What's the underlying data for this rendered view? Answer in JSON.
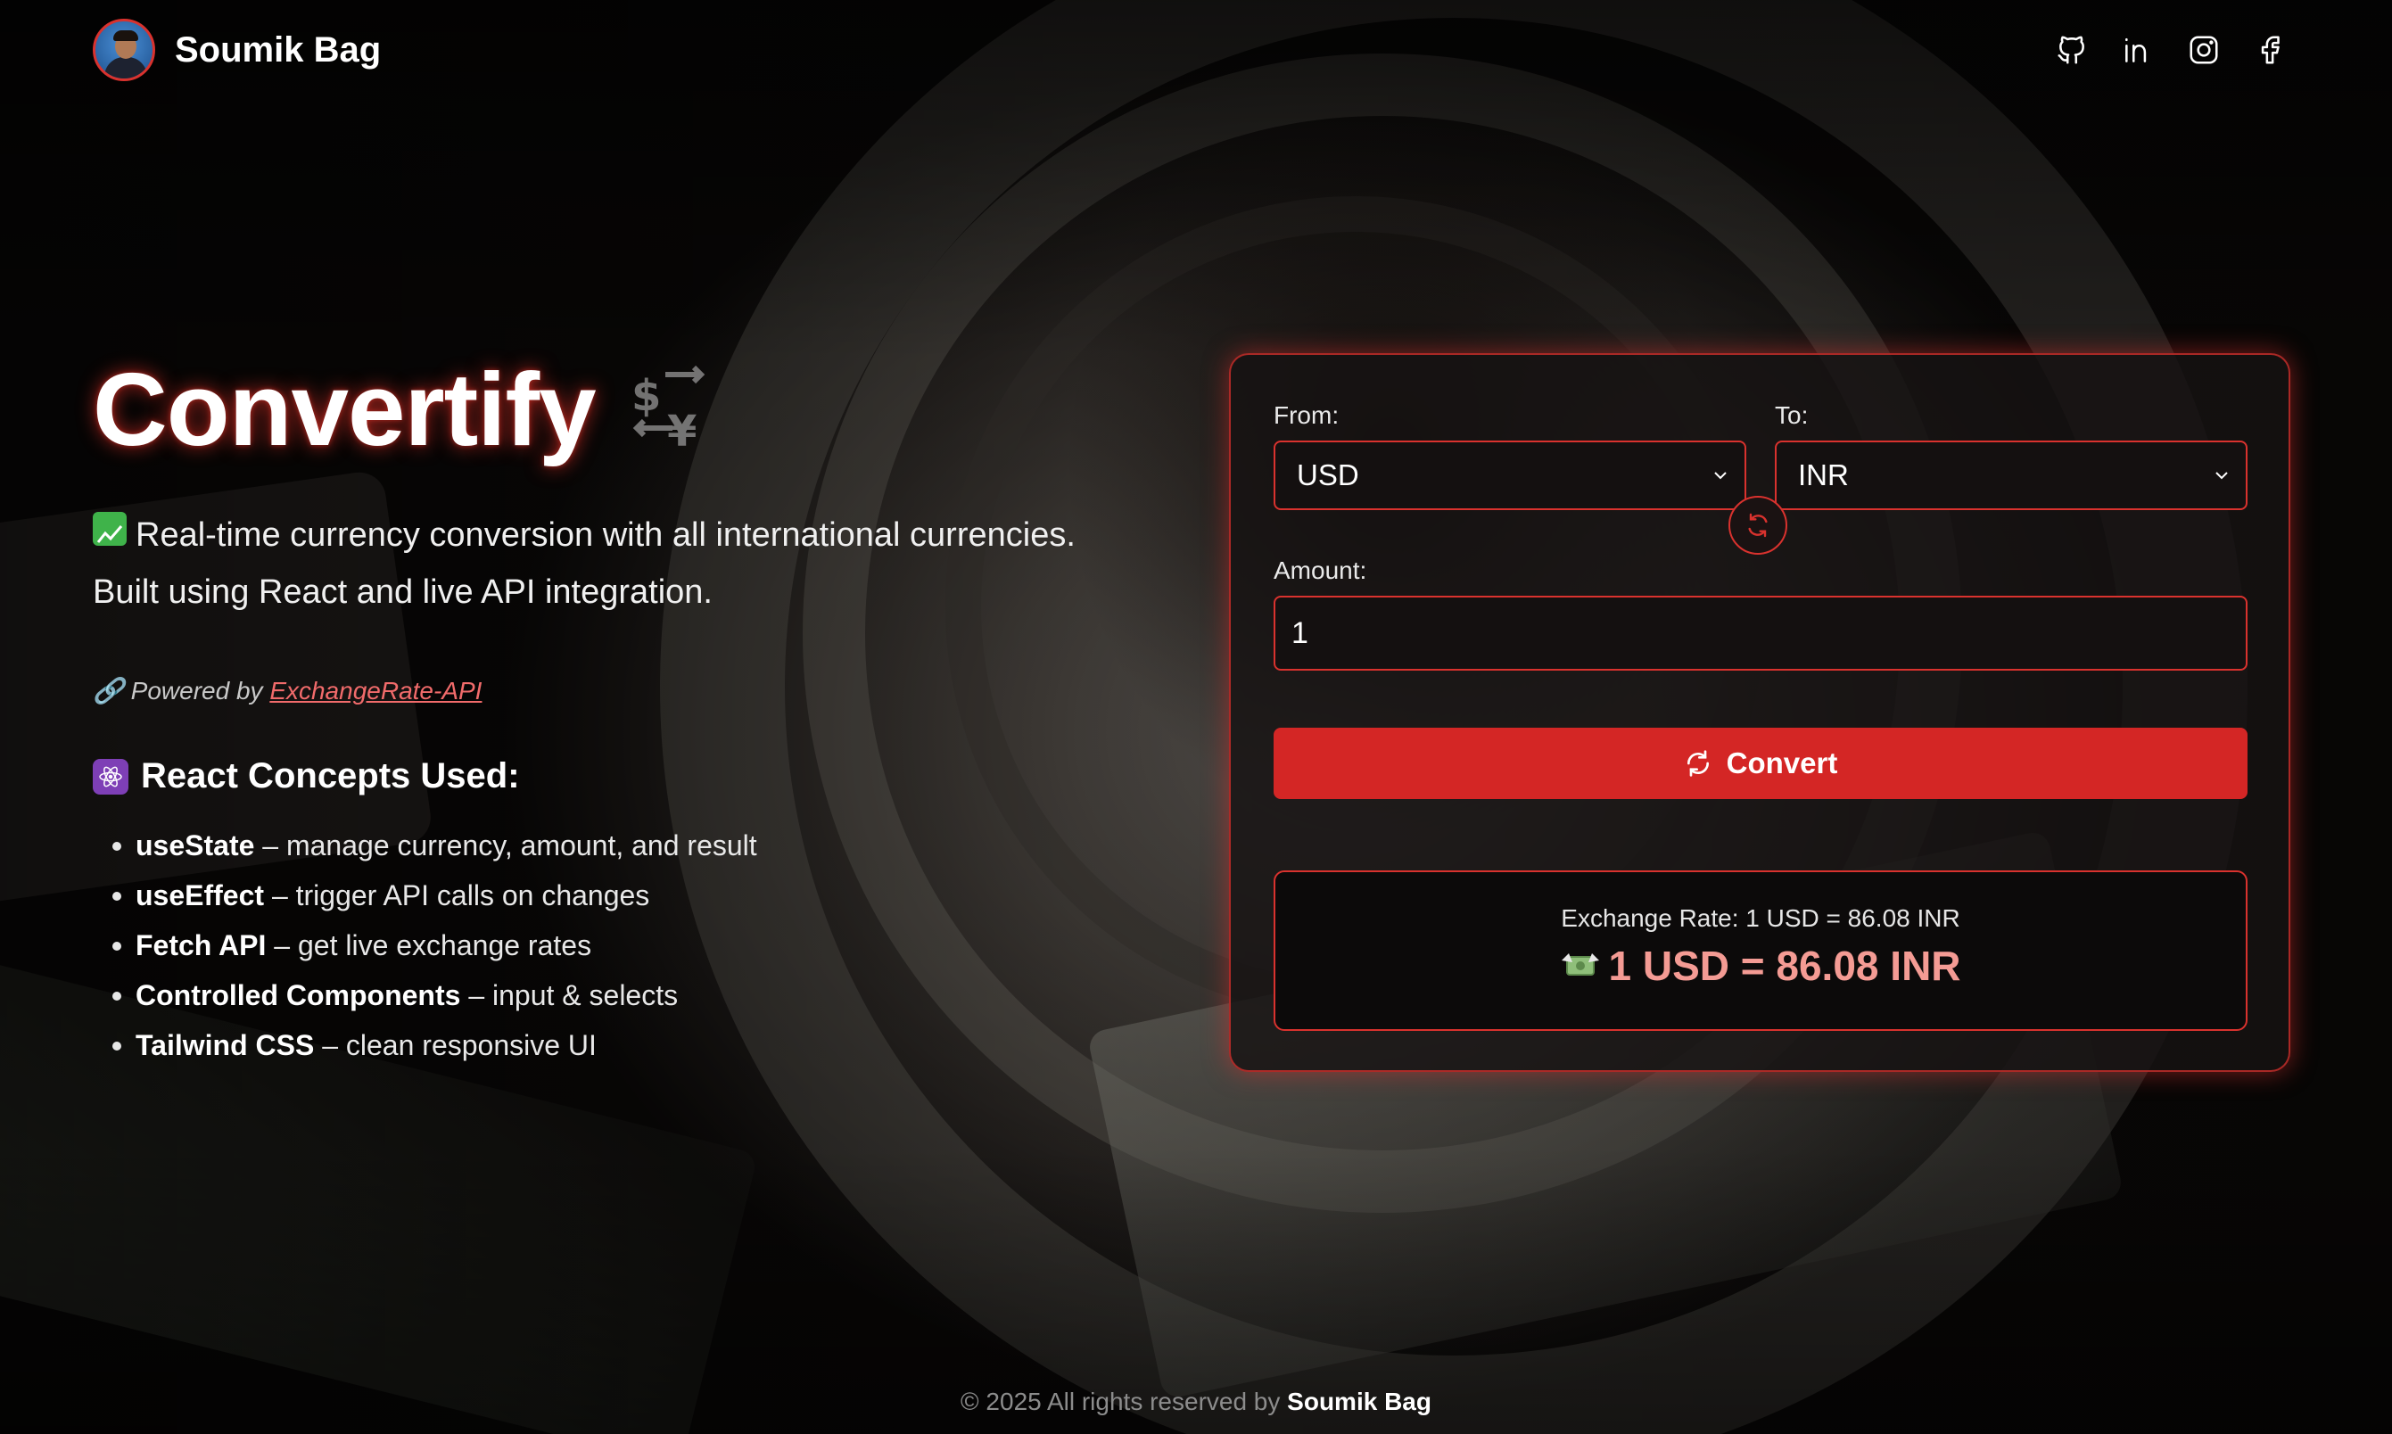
{
  "header": {
    "brand_name": "Soumik Bag",
    "socials": [
      "github-icon",
      "linkedin-icon",
      "instagram-icon",
      "facebook-icon"
    ]
  },
  "hero": {
    "title": "Convertify",
    "description_line1": "Real-time currency conversion with all international currencies.",
    "description_line2": "Built using React and live API integration.",
    "powered_prefix": "Powered by",
    "powered_link": "ExchangeRate-API"
  },
  "concepts": {
    "title": "React Concepts Used:",
    "items": [
      {
        "name": "useState",
        "desc": "– manage currency, amount, and result"
      },
      {
        "name": "useEffect",
        "desc": "– trigger API calls on changes"
      },
      {
        "name": "Fetch API",
        "desc": "– get live exchange rates"
      },
      {
        "name": "Controlled Components",
        "desc": "– input & selects"
      },
      {
        "name": "Tailwind CSS",
        "desc": "– clean responsive UI"
      }
    ]
  },
  "converter": {
    "from_label": "From:",
    "from_value": "USD",
    "to_label": "To:",
    "to_value": "INR",
    "amount_label": "Amount:",
    "amount_value": "1",
    "convert_label": "Convert",
    "rate_text": "Exchange Rate: 1 USD = 86.08 INR",
    "result_text": "1 USD = 86.08 INR"
  },
  "footer": {
    "text": "© 2025 All rights reserved by",
    "name": "Soumik Bag"
  },
  "colors": {
    "accent": "#d42625",
    "result": "#f49b94",
    "link": "#f16b6b"
  }
}
